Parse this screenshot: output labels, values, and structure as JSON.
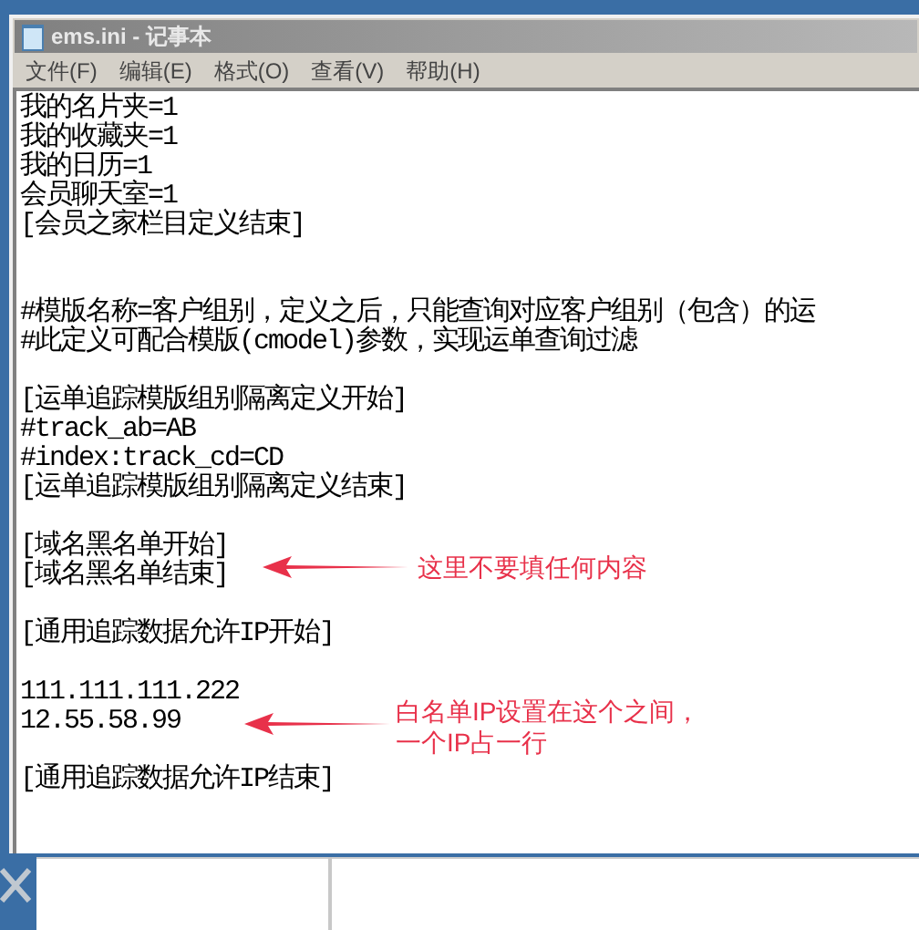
{
  "window": {
    "title": "ems.ini - 记事本"
  },
  "menu": [
    {
      "label": "文件(F)"
    },
    {
      "label": "编辑(E)"
    },
    {
      "label": "格式(O)"
    },
    {
      "label": "查看(V)"
    },
    {
      "label": "帮助(H)"
    }
  ],
  "editor": {
    "sections": [
      {
        "blocks": [
          {
            "lines": [
              "我的名片夹=1",
              "我的收藏夹=1",
              "我的日历=1",
              "会员聊天室=1",
              "[会员之家栏目定义结束]"
            ]
          }
        ]
      },
      {
        "blocks": [
          {
            "lines": [
              "#模版名称=客户组别，定义之后，只能查询对应客户组别（包含）的运",
              "#此定义可配合模版(cmodel)参数，实现运单查询过滤"
            ]
          },
          {
            "lines": [
              "[运单追踪模版组别隔离定义开始]",
              "#track_ab=AB",
              "#index:track_cd=CD",
              "[运单追踪模版组别隔离定义结束]"
            ]
          },
          {
            "lines": [
              "[域名黑名单开始]",
              "[域名黑名单结束]"
            ]
          },
          {
            "lines": [
              "[通用追踪数据允许IP开始]"
            ]
          },
          {
            "lines": [
              "111.111.111.222",
              "12.55.58.99"
            ]
          },
          {
            "lines": [
              "[通用追踪数据允许IP结束]"
            ]
          }
        ]
      }
    ]
  },
  "annotations": [
    {
      "lines": [
        "这里不要填任何内容"
      ]
    },
    {
      "lines": [
        "白名单IP设置在这个之间，",
        "一个IP占一行"
      ]
    }
  ]
}
